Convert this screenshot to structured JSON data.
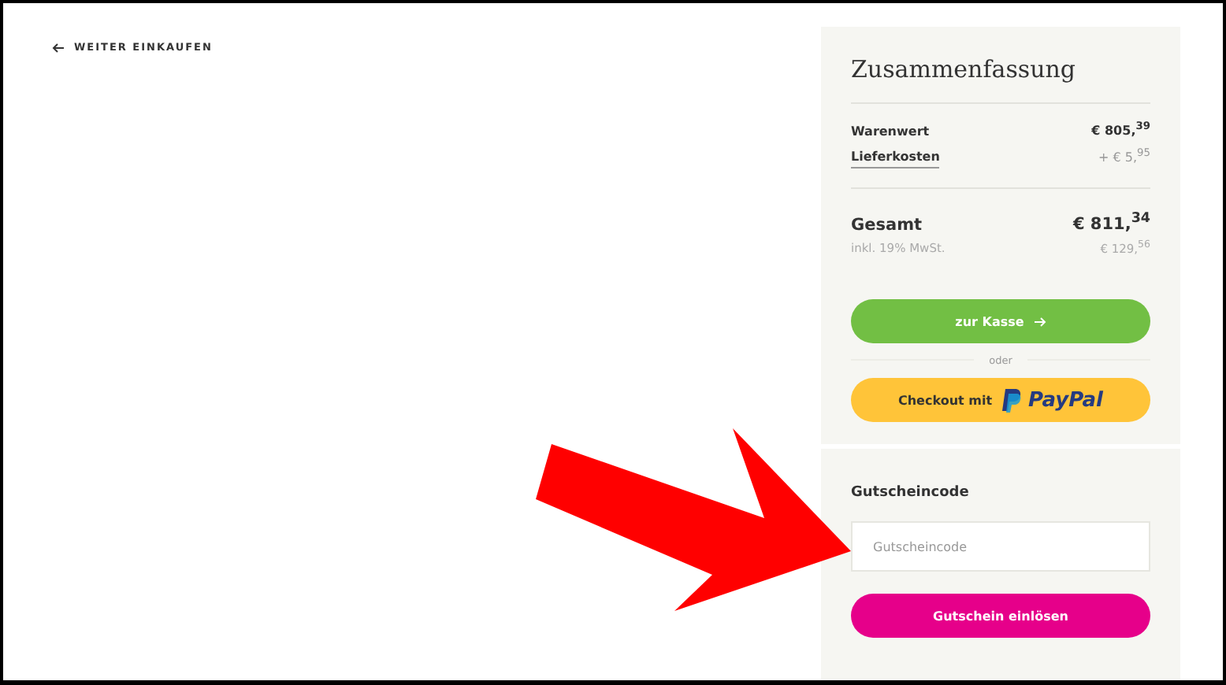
{
  "back_link": {
    "label": "WEITER EINKAUFEN"
  },
  "summary": {
    "title": "Zusammenfassung",
    "rows": [
      {
        "label": "Warenwert",
        "value": "€ 805,$^{39}$",
        "kind": "plain"
      },
      {
        "label": "Lieferkosten",
        "value": "+ € 5,$^{95}$",
        "kind": "link"
      }
    ],
    "total": {
      "label": "Gesamt",
      "value": "€ 811,$^{34}$"
    },
    "tax": {
      "label": "inkl. 19% MwSt.",
      "value": "€ 129,$^{56}$"
    },
    "checkout_button": "zur Kasse",
    "separator": "oder",
    "paypal_button": {
      "label": "Checkout mit",
      "brand": "PayPal"
    }
  },
  "voucher": {
    "title": "Gutscheincode",
    "field": {
      "placeholder": "Gutscheincode"
    },
    "button": "Gutschein einlösen"
  }
}
